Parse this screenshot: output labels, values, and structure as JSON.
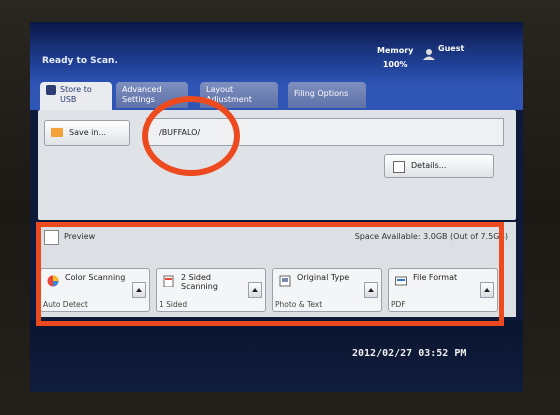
{
  "header": {
    "status": "Ready to Scan.",
    "memory_label": "Memory",
    "memory_value": "100%",
    "user": "Guest"
  },
  "tabs": [
    {
      "label": "Store to USB"
    },
    {
      "label": "Advanced Settings"
    },
    {
      "label": "Layout Adjustment"
    },
    {
      "label": "Filing Options"
    }
  ],
  "save": {
    "button_label": "Save in...",
    "path": "/BUFFALO/"
  },
  "details_label": "Details...",
  "preview_label": "Preview",
  "space": "Space Available: 3.0GB (Out of 7.5GB)",
  "options": [
    {
      "title": "Color Scanning",
      "value": "Auto Detect",
      "icon": "color-scanning-icon"
    },
    {
      "title": "2 Sided Scanning",
      "value": "1 Sided",
      "icon": "two-sided-icon"
    },
    {
      "title": "Original Type",
      "value": "Photo & Text",
      "icon": "original-type-icon"
    },
    {
      "title": "File Format",
      "value": "PDF",
      "icon": "file-format-icon"
    }
  ],
  "datetime": "2012/02/27 03:52 PM",
  "colors": {
    "annotation": "#ee4a1f",
    "header": "#1d3a8a"
  }
}
